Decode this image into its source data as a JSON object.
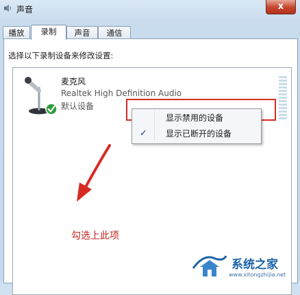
{
  "window": {
    "title": "声音",
    "close_label": "x"
  },
  "tabs": [
    {
      "label": "播放",
      "active": false
    },
    {
      "label": "录制",
      "active": true
    },
    {
      "label": "声音",
      "active": false
    },
    {
      "label": "通信",
      "active": false
    }
  ],
  "instruction": "选择以下录制设备来修改设置:",
  "device": {
    "name": "麦克风",
    "driver": "Realtek High Definition Audio",
    "status": "默认设备",
    "icon": "microphone-icon",
    "status_icon": "green-check-icon"
  },
  "context_menu": {
    "items": [
      {
        "label": "显示禁用的设备",
        "checked": false
      },
      {
        "label": "显示已断开的设备",
        "checked": true
      }
    ],
    "check_glyph": "✓"
  },
  "annotation": {
    "text": "勾选上此项",
    "color": "#c0241f",
    "highlight_color": "#d62b24"
  },
  "watermark": {
    "text": "系统之家",
    "url": "www.xitongzhijia.net"
  }
}
